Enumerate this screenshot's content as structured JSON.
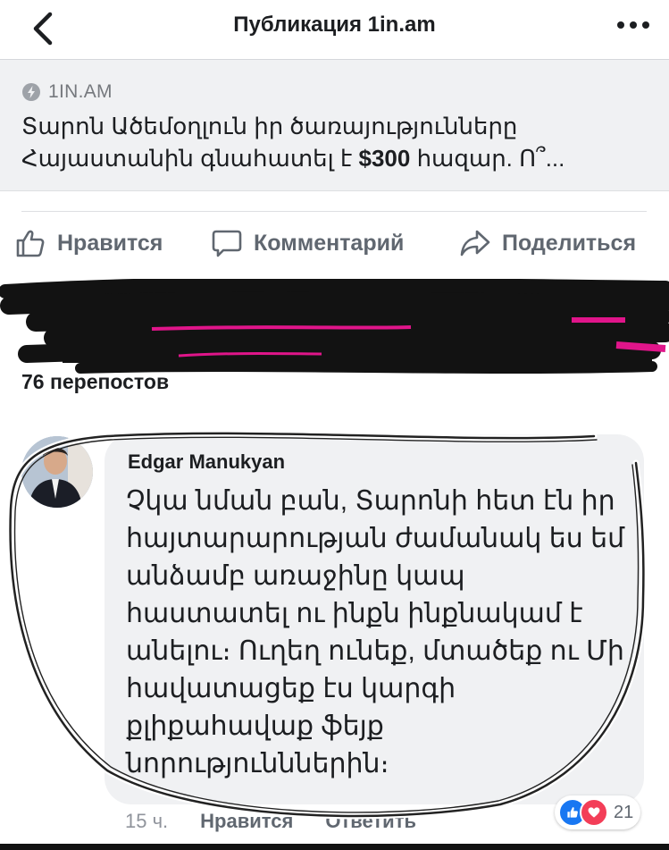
{
  "nav": {
    "title": "Публикация 1in.am",
    "back_icon": "chevron-left-icon",
    "more_icon": "more-dots-icon"
  },
  "preview": {
    "source": "1IN.AM",
    "source_icon": "lightning-icon",
    "headline_line1": "Տարոն Ածեմօղլուն իր ծառայությունները",
    "headline_line2_a": "Հայաստանին գնահատել է ",
    "headline_line2_bold": "$300",
    "headline_line2_b": " հազար. Ո՞..."
  },
  "actions": {
    "like": "Нравится",
    "comment": "Комментарий",
    "share": "Поделиться"
  },
  "reposts": "76 перепостов",
  "comment": {
    "author": "Edgar Manukyan",
    "text": "Չկա նման բան, Տարոնի հետ էն իր հայտարարության ժամանակ ես եմ անձամբ առաջինը կապ հաստատել ու ինքն ինքնակամ է անելու։ Ուղեղ ունեք, մտածեք ու Մի հավատացեք էս կարգի քլիքահավաք ֆեյք նորությունններին։",
    "time": "15 ч.",
    "like_label": "Нравится",
    "reply_label": "Ответить",
    "reaction_count": "21"
  },
  "colors": {
    "accent_blue": "#1877f2",
    "love_red": "#f33e58",
    "bubble_bg": "#f0f1f3",
    "scribble": "#121212",
    "highlight_magenta": "#e0158a"
  }
}
